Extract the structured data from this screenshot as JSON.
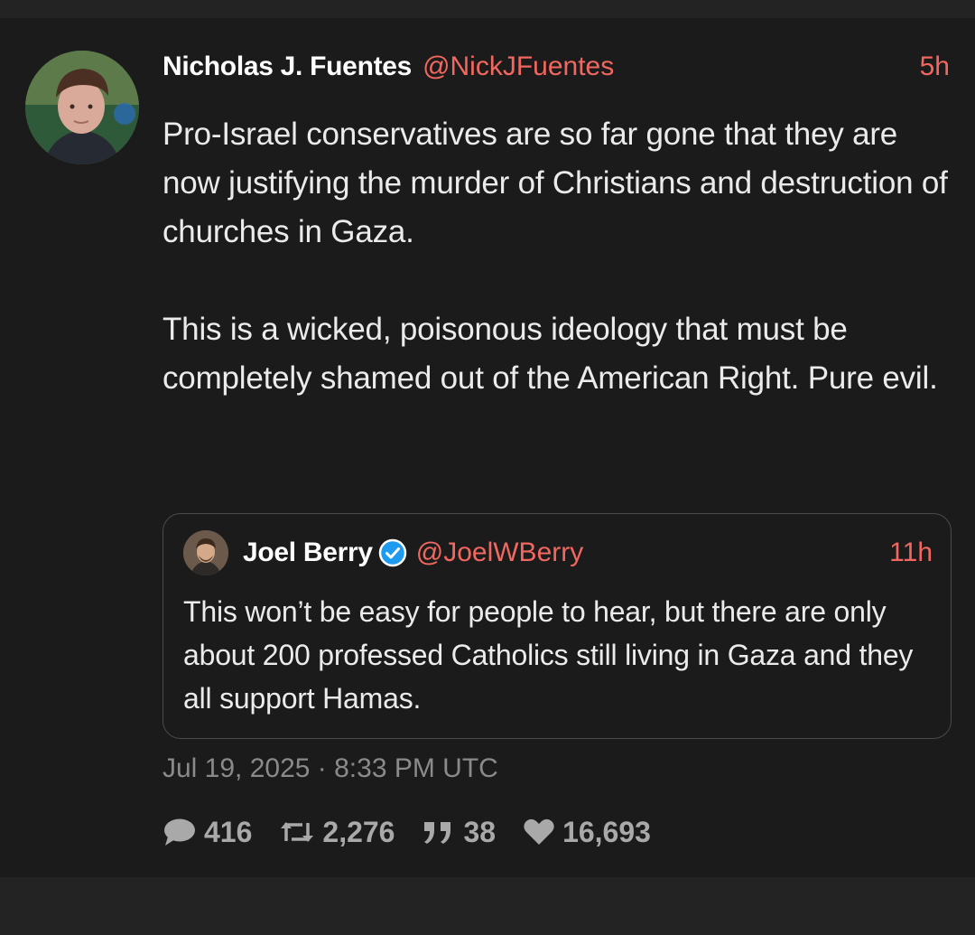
{
  "post": {
    "author": {
      "name": "Nicholas J. Fuentes",
      "handle": "@NickJFuentes"
    },
    "relative_time": "5h",
    "paragraphs": [
      "Pro-Israel conservatives are so far gone that they are now justifying the murder of Christians and destruction of churches in Gaza.",
      "This is a wicked, poisonous ideology that must be completely shamed out of the American Right. Pure evil."
    ],
    "full_timestamp": "Jul 19, 2025 · 8:33 PM UTC",
    "stats": {
      "replies": "416",
      "reposts": "2,276",
      "quotes": "38",
      "likes": "16,693"
    }
  },
  "quoted_post": {
    "author": {
      "name": "Joel Berry",
      "handle": "@JoelWBerry",
      "verified": true
    },
    "relative_time": "11h",
    "text": "This won’t be easy for people to hear, but there are only about 200 professed Catholics still living in Gaza and they all support Hamas."
  },
  "icons": {
    "replies": "comment-bubble-icon",
    "reposts": "retweet-icon",
    "quotes": "quote-marks-icon",
    "likes": "heart-icon",
    "verified": "verified-check-icon"
  },
  "colors": {
    "background": "#1b1b1b",
    "accent": "#f2675f",
    "text": "#ecebeb",
    "muted": "#8a8a8a",
    "verified": "#1d9bf0"
  }
}
